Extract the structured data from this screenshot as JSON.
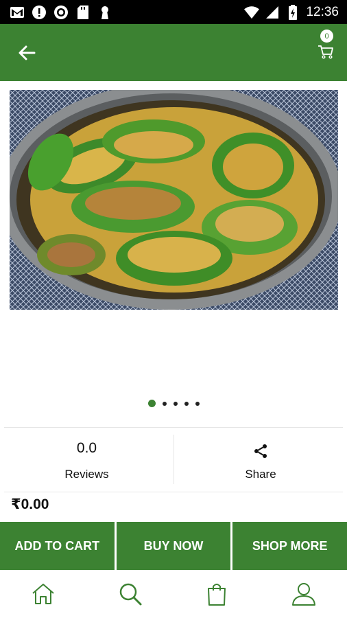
{
  "status_bar": {
    "time": "12:36",
    "icons": [
      "gmail-icon",
      "alert-icon",
      "sync-icon",
      "sd-card-icon",
      "keyhole-icon",
      "wifi-icon",
      "signal-icon",
      "battery-charging-icon"
    ]
  },
  "app_bar": {
    "back_icon": "arrow-left-icon",
    "cart_icon": "shopping-cart-icon",
    "cart_count": "0"
  },
  "product": {
    "image_alt": "stuffed green capsicum dish in steel bowl",
    "carousel": {
      "total": 5,
      "active_index": 0
    },
    "rating": "0.0",
    "reviews_label": "Reviews",
    "share_label": "Share",
    "share_icon": "share-icon",
    "price": "₹0.00"
  },
  "actions": {
    "add_to_cart": "ADD TO CART",
    "buy_now": "BUY NOW",
    "shop_more": "SHOP MORE"
  },
  "bottom_nav": {
    "items": [
      "home-icon",
      "search-icon",
      "shopping-bag-icon",
      "profile-icon"
    ]
  },
  "colors": {
    "primary": "#3c8232",
    "status_bar": "#000000"
  }
}
